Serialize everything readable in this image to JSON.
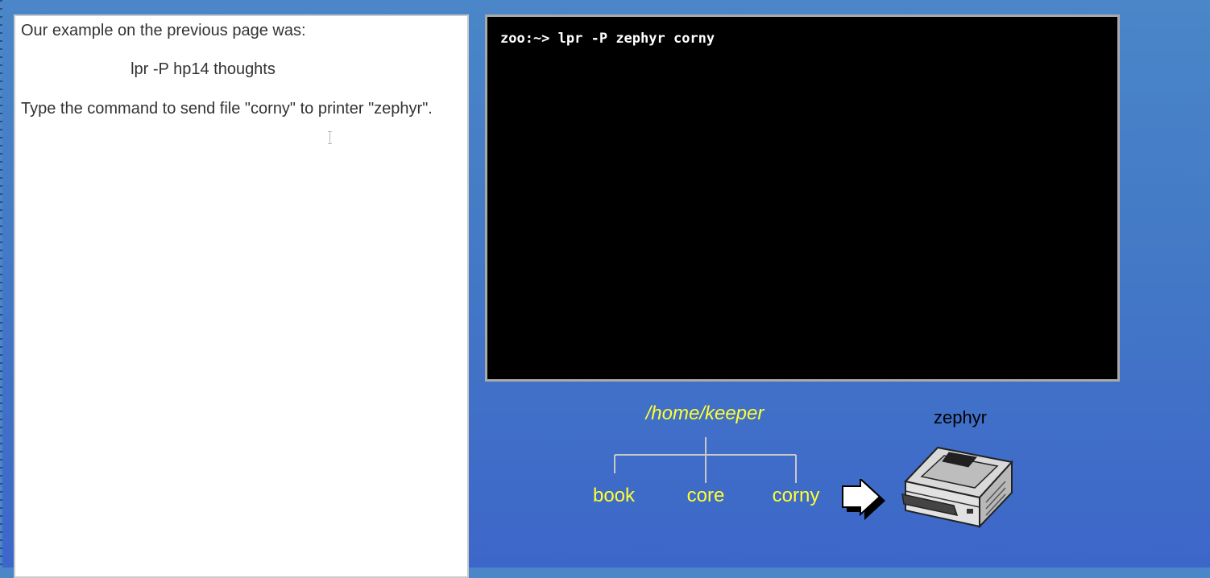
{
  "instructions": {
    "line1": "Our example on the previous page was:",
    "example_command": "lpr -P hp14 thoughts",
    "task": "Type the command to send file \"corny\" to printer \"zephyr\"."
  },
  "terminal": {
    "prompt": "zoo:~>",
    "command": "lpr -P zephyr corny"
  },
  "diagram": {
    "directory": "/home/keeper",
    "files": [
      "book",
      "core",
      "corny"
    ],
    "printer": "zephyr",
    "arrow_icon": "right-arrow-icon",
    "printer_icon": "printer-icon"
  },
  "colors": {
    "background": "#4379c6",
    "terminal_bg": "#000000",
    "terminal_text": "#ffffff",
    "diagram_text": "#ffff33"
  }
}
